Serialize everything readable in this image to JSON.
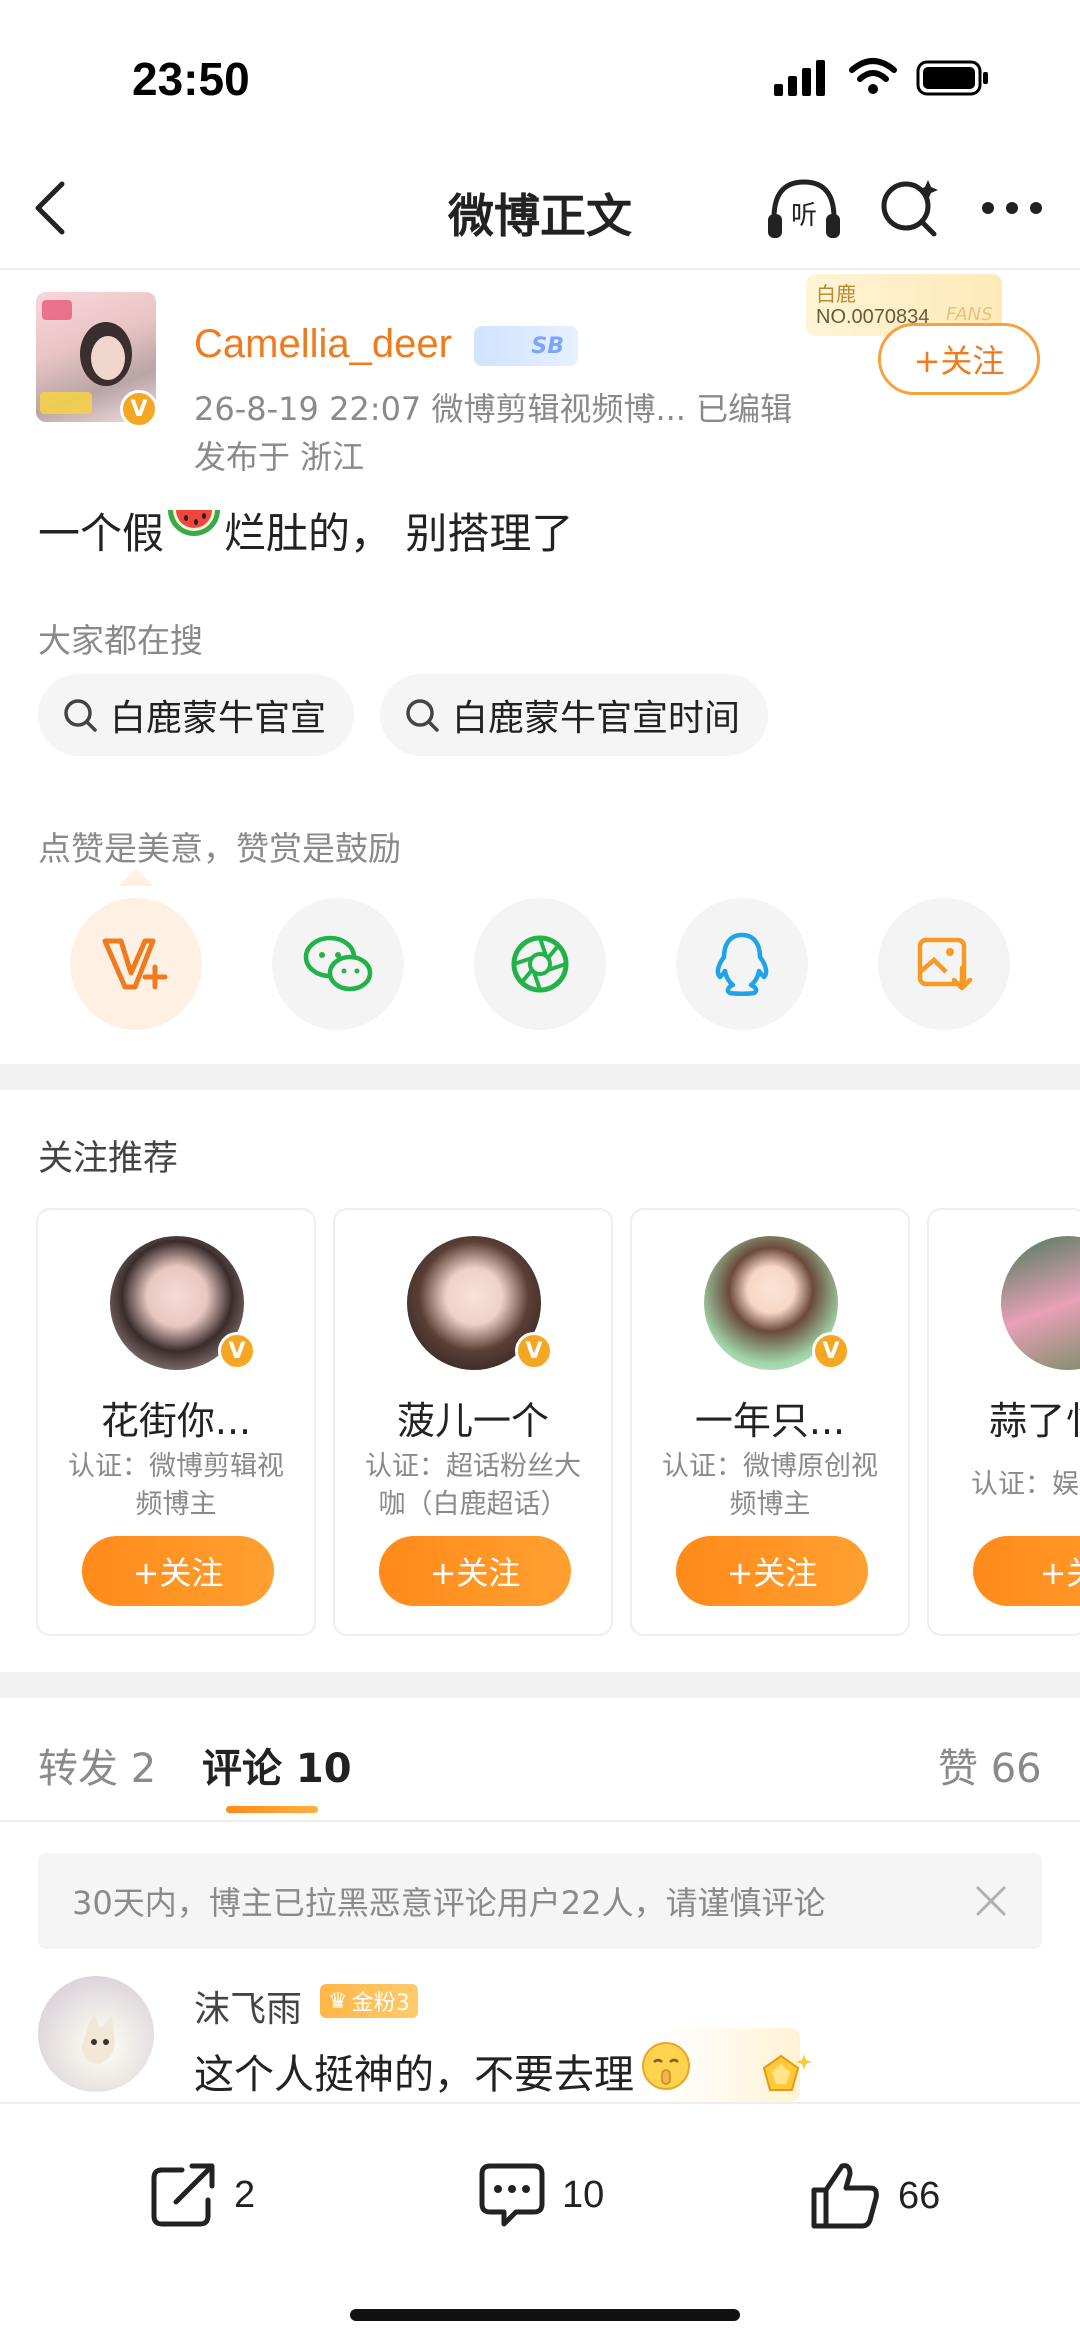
{
  "status": {
    "time": "23:50"
  },
  "nav": {
    "title": "微博正文"
  },
  "post": {
    "username": "Camellia_deer",
    "user_badge": "SB",
    "meta": "26-8-19 22:07  微博剪辑视频博... 已编辑",
    "location": "发布于 浙江",
    "fan_card_name": "白鹿",
    "fan_card_no": "NO.0070834",
    "fan_card_tag": "FANS",
    "follow_label": "+关注",
    "text_before": "一个假",
    "text_after": "烂肚的，  别搭理了"
  },
  "search": {
    "label": "大家都在搜",
    "chips": [
      "白鹿蒙牛官宣",
      "白鹿蒙牛官宣时间"
    ]
  },
  "reward": {
    "label": "点赞是美意，赞赏是鼓励"
  },
  "share_icons": [
    "reward-v-icon",
    "wechat-icon",
    "moments-icon",
    "qq-icon",
    "save-image-icon"
  ],
  "recommend": {
    "title": "关注推荐",
    "cards": [
      {
        "name": "花街你...",
        "desc": "认证：微博剪辑视频博主",
        "follow": "+关注"
      },
      {
        "name": "菠儿一个",
        "desc": "认证：超话粉丝大咖（白鹿超话）微..",
        "follow": "+关注"
      },
      {
        "name": "一年只...",
        "desc": "认证：微博原创视频博主",
        "follow": "+关注"
      },
      {
        "name": "蒜了忄",
        "desc": "认证：娱",
        "follow": "+关"
      }
    ]
  },
  "tabs": {
    "repost": "转发 2",
    "comment": "评论 10",
    "like": "赞 66"
  },
  "notice": {
    "text": "30天内，博主已拉黑恶意评论用户22人，请谨慎评论"
  },
  "comment": {
    "name": "沫飞雨",
    "badge": "金粉3",
    "text": "这个人挺神的，不要去理"
  },
  "bottom": {
    "repost": "2",
    "comment": "10",
    "like": "66"
  },
  "colors": {
    "accent": "#f07b1f",
    "follow_gradient": "#ff8a1a"
  }
}
